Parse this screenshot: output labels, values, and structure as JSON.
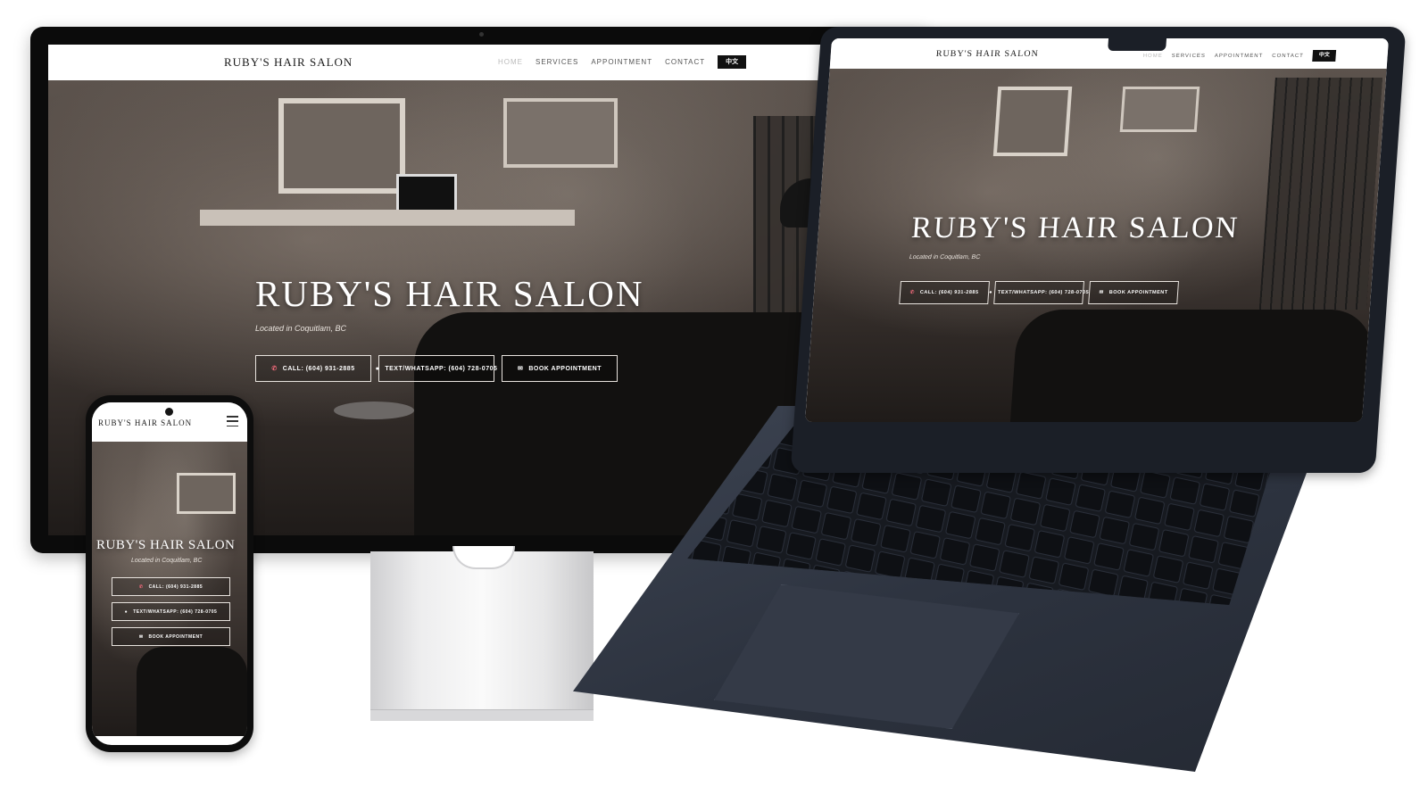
{
  "site": {
    "brand": "RUBY'S HAIR SALON",
    "nav": {
      "home": "HOME",
      "services": "SERVICES",
      "appointment": "APPOINTMENT",
      "contact": "CONTACT",
      "language": "中文"
    },
    "hero": {
      "title": "RUBY'S HAIR SALON",
      "subtitle": "Located in Coquitlam, BC",
      "call_button": "CALL: (604) 931-2885",
      "text_button": "TEXT/WHATSAPP: (604) 728-0705",
      "book_button": "BOOK APPOINTMENT"
    }
  },
  "icons": {
    "phone": "phone-icon",
    "chat": "chat-bubble-icon",
    "mail": "envelope-icon",
    "menu": "hamburger-menu-icon"
  },
  "colors": {
    "nav_background": "#ffffff",
    "language_button": "#111111",
    "hero_text": "#ffffff",
    "icon_accent": "#f06a7a",
    "laptop_body": "#2c323e"
  }
}
